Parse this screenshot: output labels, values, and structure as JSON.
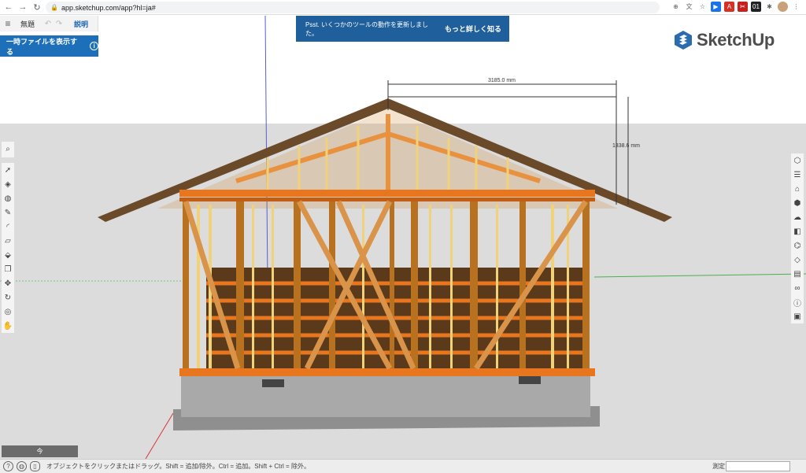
{
  "browser": {
    "url": "app.sketchup.com/app?hl=ja#",
    "icons": [
      "back-icon",
      "forward-icon",
      "reload-icon",
      "lock-icon",
      "star-icon",
      "zoom-icon",
      "pdf-icon",
      "extension-icon",
      "profile-icon",
      "menu-dots-icon"
    ]
  },
  "app": {
    "title": "無題",
    "explain_label": "説明",
    "temp_files_label": "一時ファイルを表示する"
  },
  "banner": {
    "message": "Psst. いくつかのツールの動作を更新しました。",
    "link": "もっと詳しく知る"
  },
  "logo": {
    "text": "SketchUp"
  },
  "dimensions": {
    "width_label": "3185.0 mm",
    "height_label": "1338.6 mm"
  },
  "left_tools": [
    "search-icon",
    "select-icon",
    "eraser-icon",
    "paint-icon",
    "pencil-icon",
    "arc-icon",
    "rectangle-icon",
    "pushpull-icon",
    "offset-icon",
    "move-icon",
    "rotate-icon",
    "orbit-icon",
    "pan-icon"
  ],
  "right_tools": [
    "entity-info-icon",
    "instructor-icon",
    "components-icon",
    "materials-icon",
    "styles-icon",
    "layers-icon",
    "outliner-icon",
    "tags-icon",
    "scenes-icon",
    "glasses-icon",
    "info-icon",
    "display-icon"
  ],
  "scenes_label": "今",
  "status": {
    "text": "オブジェクトをクリックまたはドラッグ。Shift = 追加/除外。Ctrl = 追加。Shift + Ctrl = 除外。",
    "measure_label": "測定"
  },
  "colors": {
    "banner_bg": "#1e5f9c",
    "accent_blue": "#1c6fb8",
    "orange": "#e8761f",
    "timber": "#b8721f",
    "foundation": "#9a9a9a"
  }
}
